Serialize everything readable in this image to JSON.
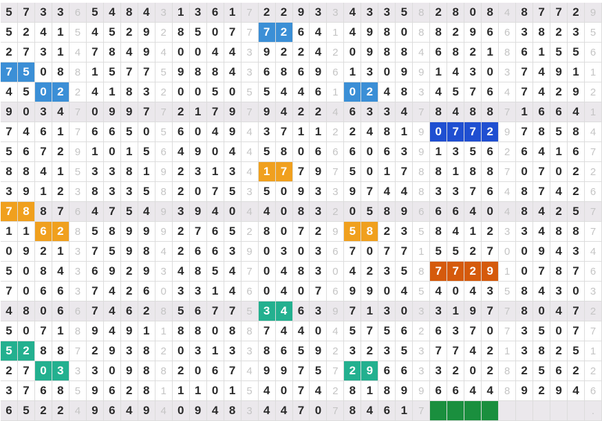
{
  "board": {
    "rows": [
      "57336548431361722933433582808487729",
      "52415452928507772641498088296638235",
      "27314784940044392242098846821861556",
      "75088157759884368696130991430374911",
      "45022418320050554461024834576474292",
      "90347099772179794224633478488716641",
      "74617665056049437112248190772978584",
      "56729101564904458066606391356264167",
      "88415338192313417797501788188707022",
      "39123833582075350933974483376487426",
      "78876475493940440832058966640484257",
      "11628589992765280729582358412334887",
      "09213759842663903036707715527009434",
      "50843692934854704830423587729107876",
      "70663742603314604076990454043584303",
      "48066746285677534639713033197780472",
      "50718949118808874404575626370735077",
      "52887293820313386592323537742138251",
      "27033309882067499757296633202825622",
      "37685962811101540742818996644892946",
      "6522496494094834470784617"
    ],
    "blank_label": "."
  },
  "highlights": [
    {
      "row": 3,
      "start": 0,
      "len": 2,
      "color": "#3b8fd6"
    },
    {
      "row": 1,
      "start": 15,
      "len": 2,
      "color": "#3b8fd6"
    },
    {
      "row": 4,
      "start": 2,
      "len": 2,
      "color": "#3b8fd6"
    },
    {
      "row": 4,
      "start": 20,
      "len": 2,
      "color": "#3b8fd6"
    },
    {
      "row": 6,
      "start": 25,
      "len": 4,
      "color": "#1f4fd1"
    },
    {
      "row": 8,
      "start": 15,
      "len": 2,
      "color": "#f0a01e"
    },
    {
      "row": 10,
      "start": 0,
      "len": 2,
      "color": "#f0a01e"
    },
    {
      "row": 11,
      "start": 2,
      "len": 2,
      "color": "#f0a01e"
    },
    {
      "row": 11,
      "start": 20,
      "len": 2,
      "color": "#f0a01e"
    },
    {
      "row": 13,
      "start": 25,
      "len": 4,
      "color": "#d55a0c"
    },
    {
      "row": 15,
      "start": 15,
      "len": 2,
      "color": "#23b08f"
    },
    {
      "row": 17,
      "start": 0,
      "len": 2,
      "color": "#23b08f"
    },
    {
      "row": 18,
      "start": 2,
      "len": 2,
      "color": "#23b08f"
    },
    {
      "row": 18,
      "start": 20,
      "len": 2,
      "color": "#23b08f"
    },
    {
      "row": 20,
      "start": 25,
      "len": 4,
      "color": "#1a8f3e"
    }
  ],
  "row_bands": [
    0,
    5,
    10,
    15,
    20
  ],
  "colors": {
    "band": "#ebe8ec",
    "grid_line": "#dcdcdc",
    "digit": "#2b2b2b",
    "separator_digit": "#c4c4c4"
  }
}
